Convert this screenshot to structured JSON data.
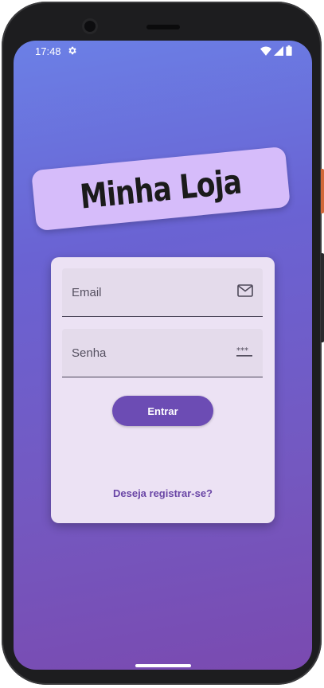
{
  "status_bar": {
    "time": "17:48",
    "icons": [
      "settings-gear-icon",
      "wifi-icon",
      "cell-signal-icon",
      "battery-icon"
    ]
  },
  "app": {
    "logo_text": "Minha Loja"
  },
  "login_form": {
    "email_placeholder": "Email",
    "email_icon": "mail-icon",
    "password_placeholder": "Senha",
    "password_icon": "password-dots-icon",
    "submit_label": "Entrar",
    "register_link": "Deseja registrar-se?"
  },
  "colors": {
    "background_gradient": [
      "#6b80e6",
      "#7a4ab0"
    ],
    "logo_background": "#d6bcfa",
    "card_background": "#ece2f4",
    "primary_button": "#6c4cb4",
    "link": "#6a46a6"
  }
}
